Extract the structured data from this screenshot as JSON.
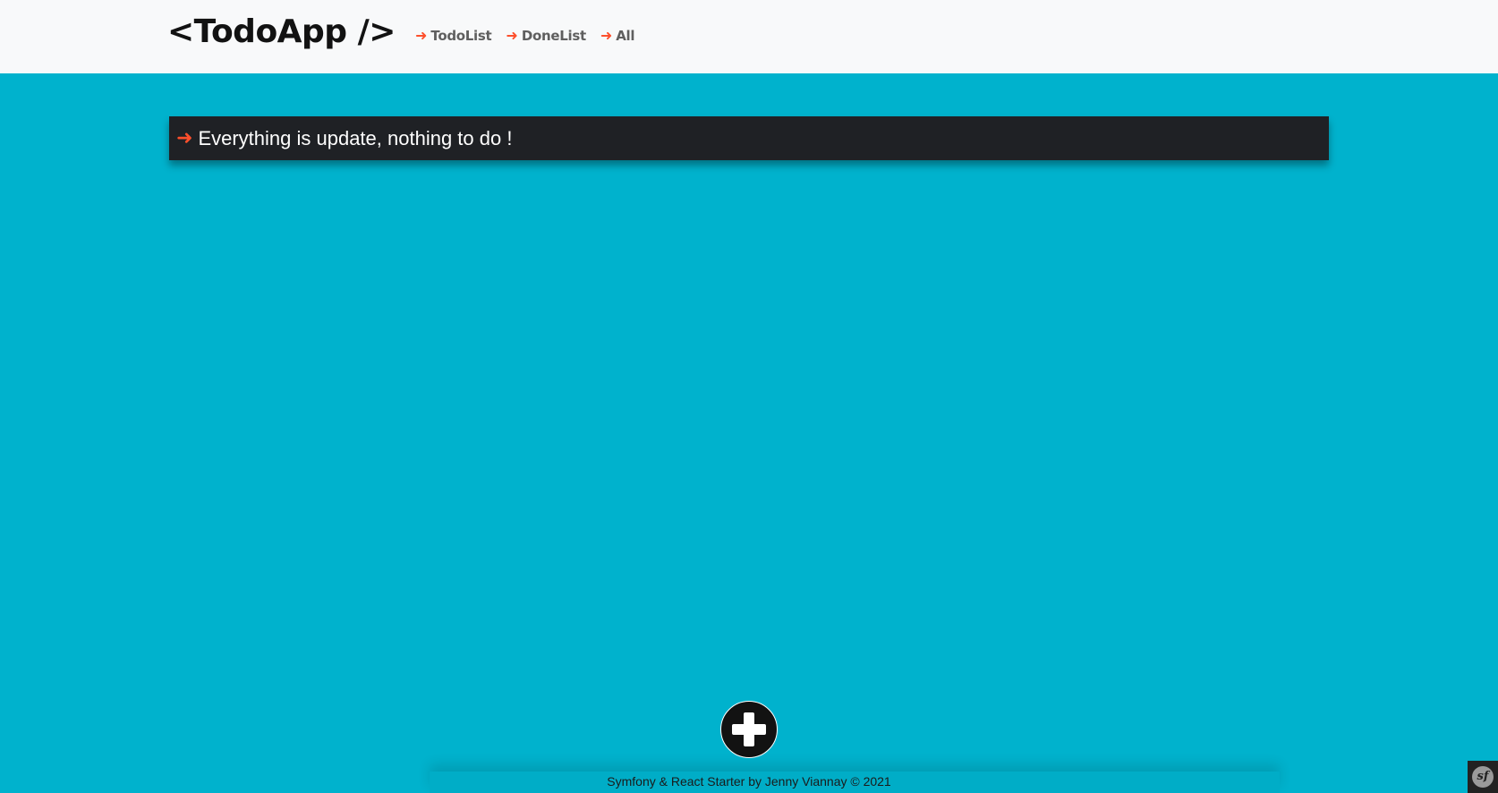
{
  "header": {
    "brand": "<TodoApp />",
    "nav": [
      {
        "arrow": "➜",
        "label": "TodoList"
      },
      {
        "arrow": "➜",
        "label": "DoneList"
      },
      {
        "arrow": "➜",
        "label": "All"
      }
    ]
  },
  "main": {
    "status_arrow": "➜",
    "status_message": "Everything is update, nothing to do !"
  },
  "add_button": {
    "icon": "plus-icon"
  },
  "footer": {
    "text": "Symfony & React Starter by Jenny Viannay © 2021"
  },
  "debug_toolbar": {
    "icon": "symfony-icon",
    "glyph": "sf"
  },
  "colors": {
    "background": "#00b2cd",
    "header_bg": "#f8f9fa",
    "accent_arrow": "#fd4f2c",
    "status_bar_bg": "#1f2125",
    "brand_text": "#121212",
    "nav_text": "#5f5f5f"
  }
}
